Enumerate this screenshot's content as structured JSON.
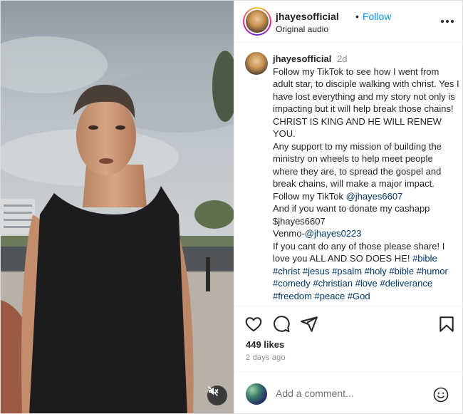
{
  "header": {
    "username": "jhayesofficial",
    "separator": "•",
    "follow_label": "Follow",
    "audio_label": "Original audio",
    "more_icon": "more-horizontal-icon"
  },
  "caption": {
    "username": "jhayesofficial",
    "time": "2d",
    "lines": [
      "Follow my TikTok to see how I went from adult star, to disciple walking with christ. Yes I have lost everything and my story not only is impacting but it will help break those chains! CHRIST IS KING AND HE WILL RENEW YOU.",
      "Any support to my mission of building the ministry on wheels to help meet people where they are, to spread the gospel and break chains, will make a major impact."
    ],
    "tiktok_prefix": "Follow my TikTok ",
    "tiktok_handle": "@jhayes6607",
    "cashapp_line": "And if you want to donate my cashapp $jhayes6607",
    "venmo_prefix": "Venmo-",
    "venmo_handle": "@jhayes0223",
    "closing": "If you cant do any of those please share! I love you ALL AND SO DOES HE! ",
    "hashtags": [
      "#bible",
      "#christ",
      "#jesus",
      "#psalm",
      "#holy",
      "#bible",
      "#humor",
      "#comedy",
      "#christian",
      "#love",
      "#deliverance",
      "#freedom",
      "#peace",
      "#God"
    ]
  },
  "actions": {
    "like_icon": "heart-icon",
    "comment_icon": "comment-icon",
    "share_icon": "send-icon",
    "save_icon": "bookmark-icon",
    "likes": "449 likes",
    "time_ago": "2 days ago"
  },
  "comment": {
    "placeholder": "Add a comment...",
    "emoji_icon": "emoji-icon"
  },
  "media": {
    "mute_icon": "muted-speaker-icon"
  },
  "colors": {
    "link": "#00376b",
    "follow": "#0095f6",
    "muted_text": "#8e8e8e"
  }
}
